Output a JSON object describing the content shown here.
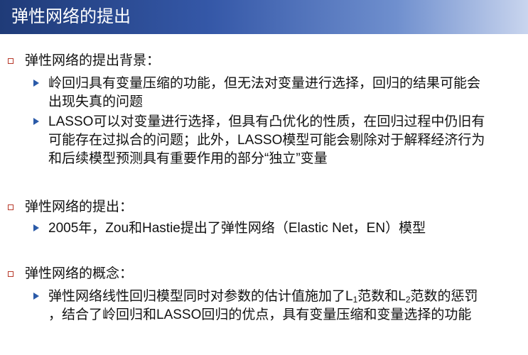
{
  "title": "弹性网络的提出",
  "sections": [
    {
      "heading": "弹性网络的提出背景：",
      "bullets": [
        {
          "lines": [
            "岭回归具有变量压缩的功能，但无法对变量进行选择，回归的结果可能会",
            "出现失真的问题"
          ]
        },
        {
          "lines": [
            "LASSO可以对变量进行选择，但具有凸优化的性质，在回归过程中仍旧有",
            "可能存在过拟合的问题；此外，LASSO模型可能会剔除对于解释经济行为",
            "和后续模型预测具有重要作用的部分“独立”变量"
          ]
        }
      ]
    },
    {
      "heading": "弹性网络的提出：",
      "bullets": [
        {
          "lines": [
            "2005年，Zou和Hastie提出了弹性网络（Elastic Net，EN）模型"
          ]
        }
      ]
    },
    {
      "heading": "弹性网络的概念：",
      "bullets": [
        {
          "line1": {
            "a": "弹性网络线性回归模型同时对参数的估计值施加了L",
            "sub1": "1",
            "b": "范数和L",
            "sub2": "2",
            "c": "范数的惩罚"
          },
          "line2": "，结合了岭回归和LASSO回归的优点，具有变量压缩和变量选择的功能"
        }
      ]
    }
  ],
  "colors": {
    "title_bg": "#1f3b78",
    "square_bullet": "#b7392a",
    "arrow_bullet": "#2a5aa8"
  },
  "icons": {
    "section_bullet": "hollow-square-icon",
    "item_bullet": "triangle-arrow-icon"
  }
}
